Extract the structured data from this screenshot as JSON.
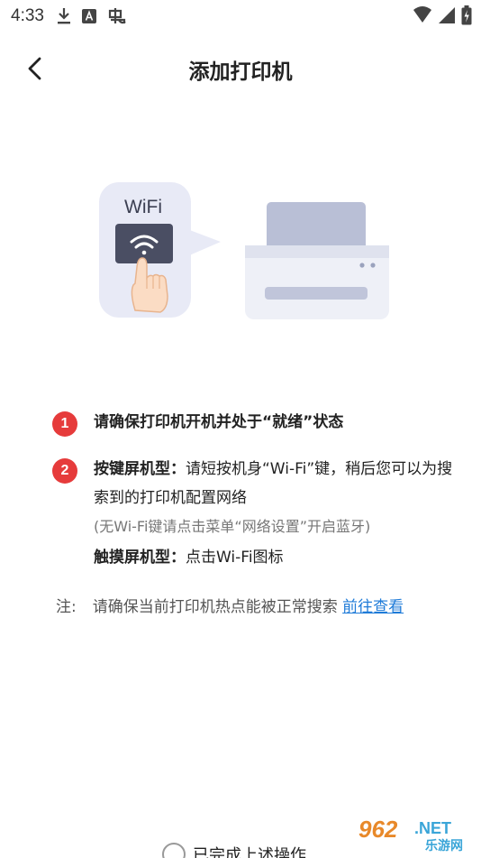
{
  "status_bar": {
    "time": "4:33"
  },
  "header": {
    "title": "添加打印机"
  },
  "illustration": {
    "wifi_label": "WiFi"
  },
  "steps": [
    {
      "number": "1",
      "text": "请确保打印机开机并处于“就绪”状态"
    },
    {
      "number": "2",
      "key_label": "按键屏机型：",
      "key_text": "请短按机身“Wi-Fi”键，稍后您可以为搜索到的打印机配置网络",
      "no_key_note": "(无Wi-Fi键请点击菜单“网络设置”开启蓝牙)",
      "touch_label": "触摸屏机型：",
      "touch_text": "点击Wi-Fi图标"
    }
  ],
  "notice": {
    "label": "注:",
    "text": "请确保当前打印机热点能被正常搜索",
    "link": "前往查看"
  },
  "confirm": {
    "label": "已完成上述操作"
  },
  "watermark": {
    "brand_number": "962",
    "brand_suffix": ".NET",
    "brand_cn": "乐游网"
  },
  "colors": {
    "accent_red": "#e63b3b",
    "link_blue": "#1f7bd8"
  }
}
